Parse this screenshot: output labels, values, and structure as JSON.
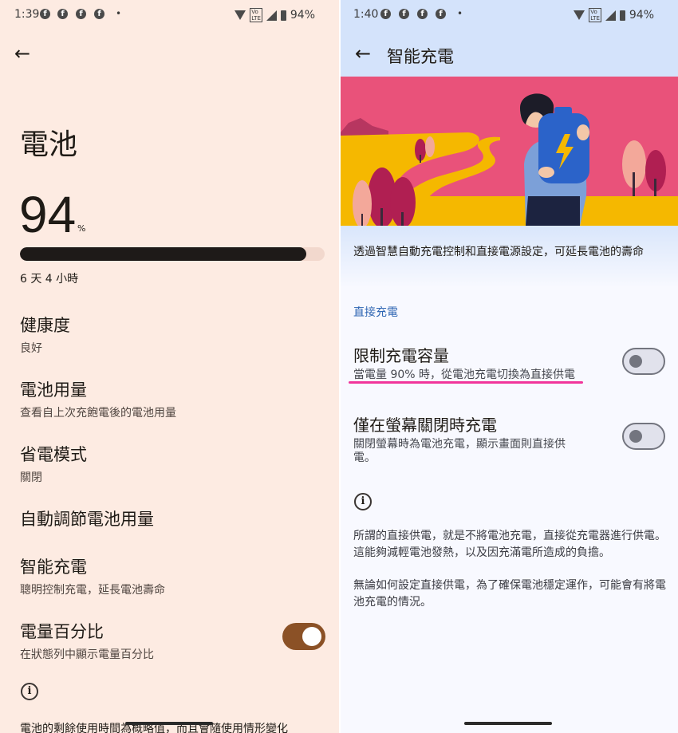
{
  "left_screen": {
    "status": {
      "time": "1:39",
      "battery": "94%"
    },
    "title": "電池",
    "battery_level": "94",
    "battery_unit": "%",
    "battery_fraction": 0.94,
    "remaining": "6 天 4 小時",
    "items": [
      {
        "title": "健康度",
        "subtitle": "良好"
      },
      {
        "title": "電池用量",
        "subtitle": "查看自上次充飽電後的電池用量"
      },
      {
        "title": "省電模式",
        "subtitle": "關閉"
      },
      {
        "title": "自動調節電池用量",
        "subtitle": ""
      },
      {
        "title": "智能充電",
        "subtitle": "聰明控制充電，延長電池壽命"
      },
      {
        "title": "電量百分比",
        "subtitle": "在狀態列中顯示電量百分比",
        "toggle_on": true
      }
    ],
    "footer": "電池的剩餘使用時間為概略值，而且會隨使用情形變化"
  },
  "right_screen": {
    "status": {
      "time": "1:40",
      "battery": "94%"
    },
    "title": "智能充電",
    "description": "透過智慧自動充電控制和直接電源設定，可延長電池的壽命",
    "section": "直接充電",
    "options": [
      {
        "title": "限制充電容量",
        "subtitle": "當電量 90% 時，從電池充電切換為直接供電",
        "toggle_on": false
      },
      {
        "title": "僅在螢幕關閉時充電",
        "subtitle": "關閉螢幕時為電池充電，顯示畫面則直接供電。",
        "toggle_on": false
      }
    ],
    "info_paragraphs": [
      "所謂的直接供電，就是不將電池充電，直接從充電器進行供電。 這能夠減輕電池發熱，以及因充滿電所造成的負擔。",
      "無論如何設定直接供電，為了確保電池穩定運作，可能會有將電池充電的情況。"
    ]
  },
  "colors": {
    "left_bg": "#fdebe2",
    "right_bg": "#f8f9ff",
    "toggle_on": "#8b5126",
    "accent_blue": "#2f66b3",
    "highlight_pink": "#f1359b",
    "banner_pink": "#e9527a",
    "banner_yellow": "#f5b800"
  }
}
